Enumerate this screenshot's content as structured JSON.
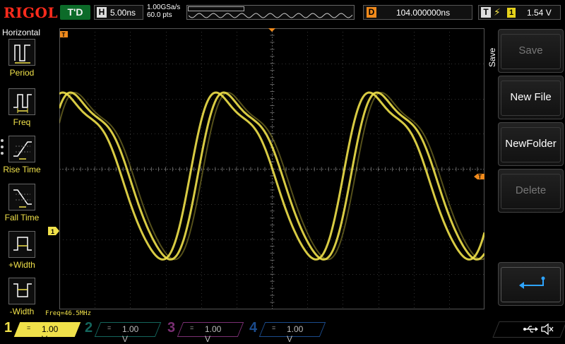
{
  "brand": "RIGOL",
  "colors": {
    "brand": "#ff2b1c",
    "ch1": "#f0e14a",
    "ch2": "#14655c",
    "ch3": "#7a2f73",
    "ch4": "#1b4b8c",
    "trigger_marker": "#f08a1c",
    "run_status_bg": "#0c6b29"
  },
  "status": {
    "trigger_status": "T'D",
    "horizontal_tag": "H",
    "timebase": "5.00ns",
    "sample_rate": "1.00GSa/s",
    "memory_depth": "60.0 pts",
    "delay_tag": "D",
    "delay": "104.000000ns",
    "trigger_tag": "T",
    "trigger_edge_icon": "rising-edge-icon",
    "trigger_source": "1",
    "trigger_level": "1.54 V"
  },
  "left_menu": {
    "title": "Horizontal",
    "items": [
      {
        "label": "Period",
        "icon": "period-icon"
      },
      {
        "label": "Freq",
        "icon": "freq-icon"
      },
      {
        "label": "Rise Time",
        "icon": "rise-time-icon"
      },
      {
        "label": "Fall Time",
        "icon": "fall-time-icon"
      },
      {
        "label": "+Width",
        "icon": "positive-width-icon"
      },
      {
        "label": "-Width",
        "icon": "negative-width-icon"
      }
    ]
  },
  "measurement": {
    "freq_readout": "Freq=46.5MHz"
  },
  "markers": {
    "trigger_pos": "T",
    "ch1_ground": "1"
  },
  "right_menu": {
    "title": "Save",
    "keys": [
      {
        "label": "Save",
        "enabled": false
      },
      {
        "label": "New File",
        "enabled": true
      },
      {
        "label": "NewFolder",
        "enabled": true
      },
      {
        "label": "Delete",
        "enabled": false
      },
      {
        "label": "",
        "icon": "return-arrow-icon",
        "enabled": true
      }
    ]
  },
  "channels": [
    {
      "num": "1",
      "coupling": "=",
      "scale": "1.00 V",
      "active": true
    },
    {
      "num": "2",
      "coupling": "=",
      "scale": "1.00 V",
      "active": false
    },
    {
      "num": "3",
      "coupling": "=",
      "scale": "1.00 V",
      "active": false
    },
    {
      "num": "4",
      "coupling": "=",
      "scale": "1.00 V",
      "active": false
    }
  ],
  "systray": {
    "usb_icon": "usb-icon",
    "sound_icon": "speaker-muted-icon"
  }
}
